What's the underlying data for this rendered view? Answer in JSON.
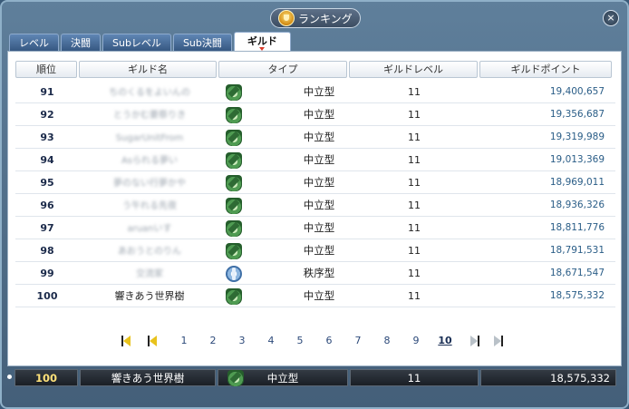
{
  "window": {
    "title": "ランキング",
    "close_label": "×"
  },
  "tabs": [
    {
      "label": "レベル",
      "active": false
    },
    {
      "label": "決闘",
      "active": false
    },
    {
      "label": "Subレベル",
      "active": false
    },
    {
      "label": "Sub決闘",
      "active": false
    },
    {
      "label": "ギルド",
      "active": true
    }
  ],
  "columns": {
    "rank": "順位",
    "guild_name": "ギルド名",
    "type": "タイプ",
    "guild_level": "ギルドレベル",
    "guild_points": "ギルドポイント"
  },
  "rows": [
    {
      "rank": "91",
      "name": "ちのくるをよいんの",
      "name_blurred": true,
      "type_icon": "neutral-icon",
      "type": "中立型",
      "level": "11",
      "points": "19,400,657"
    },
    {
      "rank": "92",
      "name": "とうかむ要祭りき",
      "name_blurred": true,
      "type_icon": "neutral-icon",
      "type": "中立型",
      "level": "11",
      "points": "19,356,687"
    },
    {
      "rank": "93",
      "name": "SugarUnitFrom",
      "name_blurred": true,
      "type_icon": "neutral-icon",
      "type": "中立型",
      "level": "11",
      "points": "19,319,989"
    },
    {
      "rank": "94",
      "name": "Asられる夢い",
      "name_blurred": true,
      "type_icon": "neutral-icon",
      "type": "中立型",
      "level": "11",
      "points": "19,013,369"
    },
    {
      "rank": "95",
      "name": "夢のない行夢かや",
      "name_blurred": true,
      "type_icon": "neutral-icon",
      "type": "中立型",
      "level": "11",
      "points": "18,969,011"
    },
    {
      "rank": "96",
      "name": "う午れる先夜",
      "name_blurred": true,
      "type_icon": "neutral-icon",
      "type": "中立型",
      "level": "11",
      "points": "18,936,326"
    },
    {
      "rank": "97",
      "name": "aruanいす",
      "name_blurred": true,
      "type_icon": "neutral-icon",
      "type": "中立型",
      "level": "11",
      "points": "18,811,776"
    },
    {
      "rank": "98",
      "name": "あおうとのりん",
      "name_blurred": true,
      "type_icon": "neutral-icon",
      "type": "中立型",
      "level": "11",
      "points": "18,791,531"
    },
    {
      "rank": "99",
      "name": "交流家",
      "name_blurred": true,
      "type_icon": "order-icon",
      "type": "秩序型",
      "level": "11",
      "points": "18,671,547"
    },
    {
      "rank": "100",
      "name": "響きあう世界樹",
      "name_blurred": false,
      "type_icon": "neutral-icon",
      "type": "中立型",
      "level": "11",
      "points": "18,575,332"
    }
  ],
  "pagination": {
    "pages": [
      "1",
      "2",
      "3",
      "4",
      "5",
      "6",
      "7",
      "8",
      "9",
      "10"
    ],
    "current": "10"
  },
  "my_guild": {
    "rank": "100",
    "name": "響きあう世界樹",
    "type_icon": "neutral-icon",
    "type": "中立型",
    "level": "11",
    "points": "18,575,332"
  },
  "colors": {
    "frame": "#4f6f8c",
    "tab_active": "#ffffff",
    "points_text": "#2a5d87",
    "my_rank_text": "#ffe27a"
  }
}
